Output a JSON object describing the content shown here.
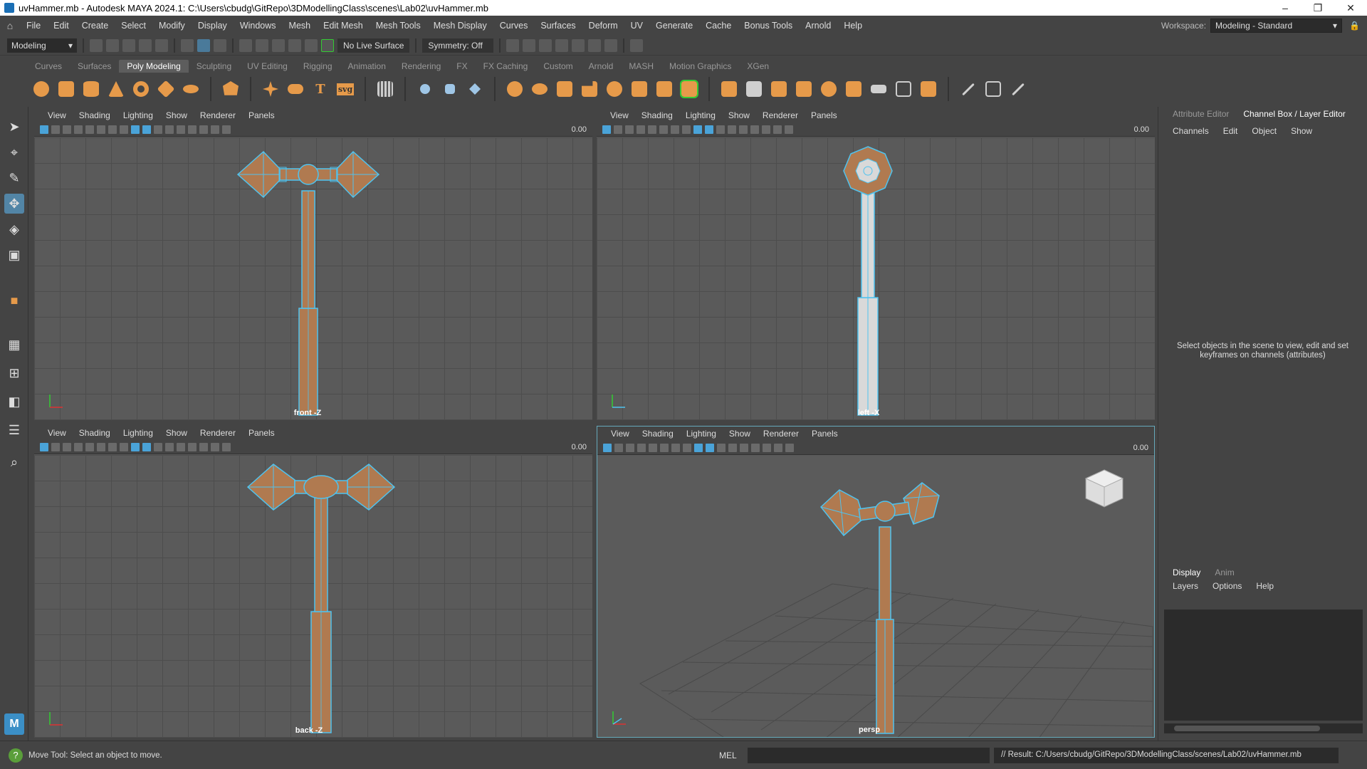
{
  "window": {
    "title": "uvHammer.mb - Autodesk MAYA 2024.1: C:\\Users\\cbudg\\GitRepo\\3DModellingClass\\scenes\\Lab02\\uvHammer.mb",
    "min": "–",
    "max": "❐",
    "close": "✕"
  },
  "menu": [
    "File",
    "Edit",
    "Create",
    "Select",
    "Modify",
    "Display",
    "Windows",
    "Mesh",
    "Edit Mesh",
    "Mesh Tools",
    "Mesh Display",
    "Curves",
    "Surfaces",
    "Deform",
    "UV",
    "Generate",
    "Cache",
    "Bonus Tools",
    "Arnold",
    "Help"
  ],
  "workspace": {
    "label": "Workspace:",
    "value": "Modeling - Standard"
  },
  "status": {
    "mode": "Modeling",
    "live_surface": "No Live Surface",
    "symmetry": "Symmetry: Off"
  },
  "shelf_tabs": [
    "Curves",
    "Surfaces",
    "Poly Modeling",
    "Sculpting",
    "UV Editing",
    "Rigging",
    "Animation",
    "Rendering",
    "FX",
    "FX Caching",
    "Custom",
    "Arnold",
    "MASH",
    "Motion Graphics",
    "XGen"
  ],
  "shelf_active": "Poly Modeling",
  "panel_menu": [
    "View",
    "Shading",
    "Lighting",
    "Show",
    "Renderer",
    "Panels"
  ],
  "panels": [
    {
      "camera": "front -Z",
      "value": "0.00"
    },
    {
      "camera": "left -X",
      "value": "0.00"
    },
    {
      "camera": "back -Z",
      "value": "0.00"
    },
    {
      "camera": "persp",
      "value": "0.00"
    }
  ],
  "right_panel": {
    "tabs": [
      "Attribute Editor",
      "Channel Box / Layer Editor"
    ],
    "sub": [
      "Channels",
      "Edit",
      "Object",
      "Show"
    ],
    "message": "Select objects in the scene to view, edit and set keyframes on channels (attributes)",
    "layer_tabs": [
      "Display",
      "Anim"
    ],
    "layer_menu": [
      "Layers",
      "Options",
      "Help"
    ]
  },
  "help_line": "Move Tool: Select an object to move.",
  "command": {
    "lang": "MEL",
    "result": "// Result: C:/Users/cbudg/GitRepo/3DModellingClass/scenes/Lab02/uvHammer.mb"
  },
  "colors": {
    "wood": "#b07a50",
    "wire": "#4fc3ef",
    "accent": "#e69a4a",
    "viewport": "#5a5a5a"
  }
}
